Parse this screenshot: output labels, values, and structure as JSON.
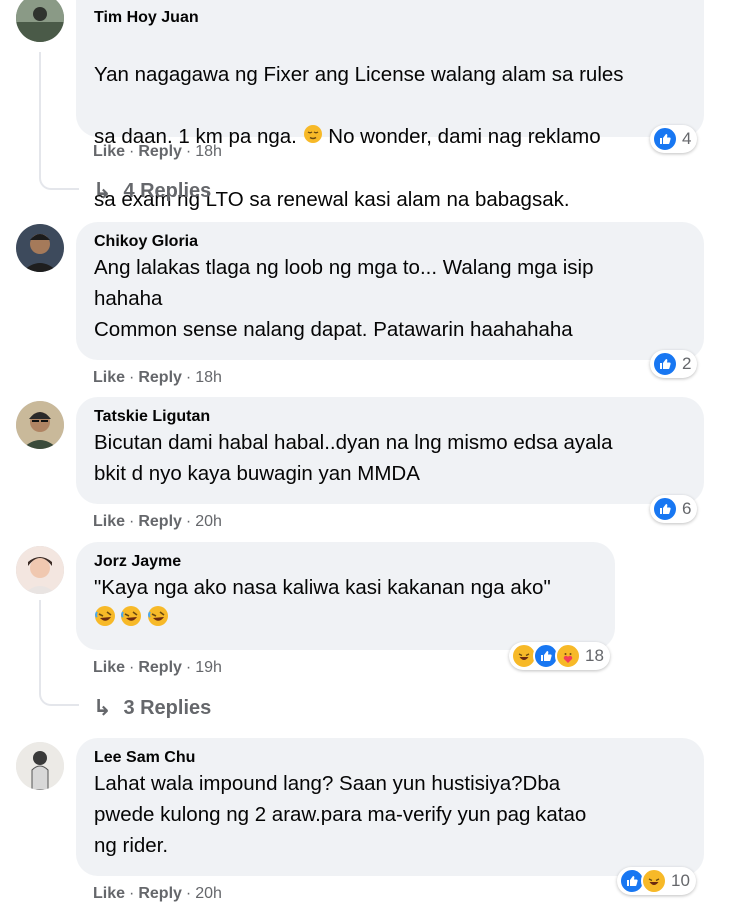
{
  "actions": {
    "like": "Like",
    "reply": "Reply",
    "dot": "·"
  },
  "comments": [
    {
      "author": "Tim Hoy Juan",
      "text_line1": "Yan nagagawa ng Fixer ang License walang alam sa rules",
      "text_line2": "sa daan. 1 km pa nga.",
      "text_line2_after": "No wonder, dami nag reklamo",
      "text_line3": "sa exam ng LTO sa renewal kasi alam na babagsak.",
      "time": "18h",
      "reactions": {
        "icons": [
          "like-icon"
        ],
        "count": "4"
      },
      "replies_label": "4 Replies"
    },
    {
      "author": "Chikoy Gloria",
      "text": "Ang lalakas tlaga ng loob ng mga to... Walang mga isip\nhahaha\nCommon sense nalang dapat. Patawarin haahahaha",
      "time": "18h",
      "reactions": {
        "icons": [
          "like-icon"
        ],
        "count": "2"
      }
    },
    {
      "author": "Tatskie Ligutan",
      "text": "Bicutan dami habal habal..dyan na lng mismo edsa ayala\nbkit d nyo kaya buwagin yan MMDA",
      "time": "20h",
      "reactions": {
        "icons": [
          "like-icon"
        ],
        "count": "6"
      }
    },
    {
      "author": "Jorz Jayme",
      "text": "\"Kaya nga ako nasa kaliwa kasi kakanan nga ako\"",
      "time": "19h",
      "reactions": {
        "icons": [
          "haha-icon",
          "like-icon",
          "care-icon"
        ],
        "count": "18"
      },
      "replies_label": "3 Replies"
    },
    {
      "author": "Lee Sam Chu",
      "text": "Lahat wala impound lang? Saan yun hustisiya?Dba\npwede kulong ng 2 araw.para ma-verify yun pag katao\nng rider.",
      "time": "20h",
      "reactions": {
        "icons": [
          "like-icon",
          "haha-icon"
        ],
        "count": "10"
      }
    }
  ],
  "colors": {
    "bubble": "#f0f2f5",
    "meta": "#65676b",
    "like": "#1877f2",
    "haha": "#f7b928"
  }
}
